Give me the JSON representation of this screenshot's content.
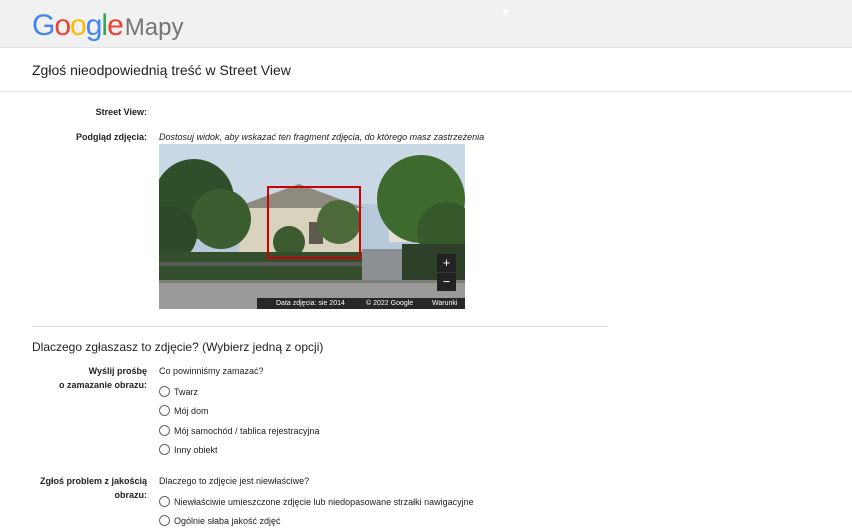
{
  "header": {
    "logo_letters": [
      {
        "ch": "G",
        "color": "#4285F4"
      },
      {
        "ch": "o",
        "color": "#EA4335"
      },
      {
        "ch": "o",
        "color": "#FBBC05"
      },
      {
        "ch": "g",
        "color": "#4285F4"
      },
      {
        "ch": "l",
        "color": "#34A853"
      },
      {
        "ch": "e",
        "color": "#EA4335"
      }
    ],
    "logo_product": "Mapy"
  },
  "page": {
    "title": "Zgłoś nieodpowiednią treść w Street View"
  },
  "form": {
    "street_view_label": "Street View:",
    "preview_label": "Podgląd zdjęcia:",
    "preview_hint": "Dostosuj widok, aby wskazać ten fragment zdjęcia, do którego masz zastrzeżenia",
    "photo": {
      "zoom_in": "+",
      "zoom_out": "−",
      "date_text": "Data zdjęcia: sie 2014",
      "copyright_text": "© 2022 Google",
      "terms_text": "Warunki"
    }
  },
  "reason": {
    "title": "Dlaczego zgłaszasz to zdjęcie?  (Wybierz jedną z opcji)",
    "blur": {
      "label_line1": "Wyślij prośbę",
      "label_line2": "o zamazanie obrazu:",
      "question": "Co powinniśmy zamazać?",
      "options": [
        "Twarz",
        "Mój dom",
        "Mój samochód / tablica rejestracyjna",
        "Inny obiekt"
      ]
    },
    "quality": {
      "label_line1": "Zgłoś problem z jakością",
      "label_line2": "obrazu:",
      "question": "Dlaczego to zdjęcie jest niewłaściwe?",
      "options": [
        "Niewłaściwie umieszczone zdjęcie lub niedopasowane strzałki nawigacyjne",
        "Ogólnie słaba jakość zdjęć"
      ]
    }
  }
}
